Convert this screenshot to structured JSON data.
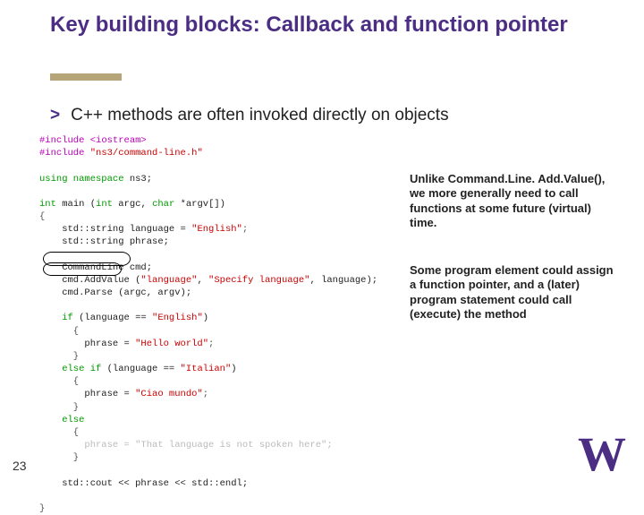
{
  "title": "Key building blocks:  Callback and function pointer",
  "bullet": {
    "arrow": ">",
    "text": "C++ methods are often invoked directly on objects"
  },
  "code": {
    "l01a": "#include ",
    "l01b": "<iostream>",
    "l02a": "#include ",
    "l02b": "\"ns3/command-line.h\"",
    "l03": "",
    "l04a": "using namespace ",
    "l04b": "ns3;",
    "l05": "",
    "l06a": "int ",
    "l06b": "main (",
    "l06c": "int ",
    "l06d": "argc, ",
    "l06e": "char ",
    "l06f": "*argv[])",
    "l07": "{",
    "l08a": "    std::string language = ",
    "l08b": "\"English\"",
    "l08c": ";",
    "l09": "    std::string phrase;",
    "l10": "",
    "l11": "    CommandLine cmd;",
    "l12a": "    cmd.AddValue (",
    "l12b": "\"language\"",
    "l12c": ", ",
    "l12d": "\"Specify language\"",
    "l12e": ", language);",
    "l13": "    cmd.Parse (argc, argv);",
    "l14": "",
    "l15a": "    if ",
    "l15b": "(language == ",
    "l15c": "\"English\"",
    "l15d": ")",
    "l16": "      {",
    "l17a": "        phrase = ",
    "l17b": "\"Hello world\"",
    "l17c": ";",
    "l18": "      }",
    "l19a": "    else if ",
    "l19b": "(language == ",
    "l19c": "\"Italian\"",
    "l19d": ")",
    "l20": "      {",
    "l21a": "        phrase = ",
    "l21b": "\"Ciao mundo\"",
    "l21c": ";",
    "l22": "      }",
    "l23a": "    else",
    "l24": "      {",
    "l25a": "        phrase = ",
    "l25b": "\"That language is not spoken here\"",
    "l25c": ";",
    "l26": "      }",
    "l27": "",
    "l28": "    std::cout << phrase << std::endl;",
    "l29": "",
    "l30": "}"
  },
  "notes": {
    "n1": "Unlike Command.Line. Add.Value(), we more generally need to call functions at some future (virtual) time.",
    "n2": "Some program element could assign a function pointer, and a (later) program statement could call (execute) the method"
  },
  "pageNumber": "23",
  "logo": "W"
}
